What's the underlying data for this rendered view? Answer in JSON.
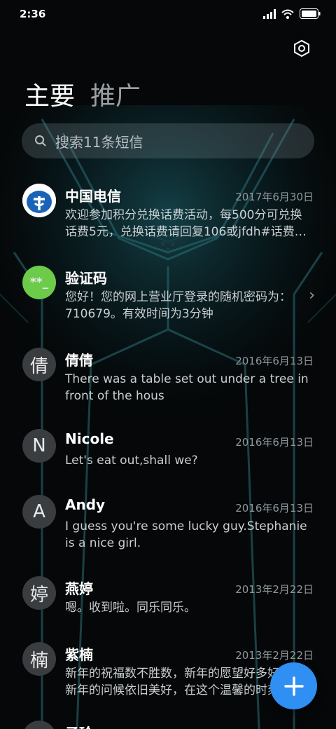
{
  "status_bar": {
    "time": "2:36"
  },
  "tabs": [
    {
      "label": "主要"
    },
    {
      "label": "推广"
    }
  ],
  "search": {
    "placeholder": "搜索11条短信"
  },
  "conversations": [
    {
      "name": "中国电信",
      "date": "2017年6月30日",
      "preview": "欢迎参加积分兑换话费活动，每500分可兑换话费5元，兑换话费请回复106或jfdh#话费…",
      "avatar": "china-telecom-logo"
    },
    {
      "name": "验证码",
      "date": "",
      "preview": "您好！您的网上营业厅登录的随机密码为：710679。有效时间为3分钟",
      "avatar_text": "**_",
      "avatar_color": "#6ccc4a"
    },
    {
      "name": "倩倩",
      "date": "2016年6月13日",
      "preview": "There was a table set out under a tree in front of the hous",
      "avatar_text": "倩"
    },
    {
      "name": "Nicole",
      "date": "2016年6月13日",
      "preview": "Let's eat out,shall we?",
      "avatar_text": "N"
    },
    {
      "name": "Andy",
      "date": "2016年6月13日",
      "preview": "I guess you're some lucky guy.Stephanie is a nice girl.",
      "avatar_text": "A"
    },
    {
      "name": "燕婷",
      "date": "2013年2月22日",
      "preview": "嗯。收到啦。同乐同乐。",
      "avatar_text": "婷"
    },
    {
      "name": "紫楠",
      "date": "2013年2月22日",
      "preview": "新年的祝福数不胜数，新年的愿望好多好多，新年的问候依旧美好，在这个温馨的时刻",
      "avatar_text": "楠"
    }
  ],
  "partial_next_name": "子玲",
  "colors": {
    "accent": "#2f8ff2",
    "background": "#050708"
  },
  "icons": [
    "signal-icon",
    "wifi-icon",
    "battery-icon",
    "settings-icon",
    "search-icon",
    "chevron-right-icon",
    "plus-icon"
  ]
}
